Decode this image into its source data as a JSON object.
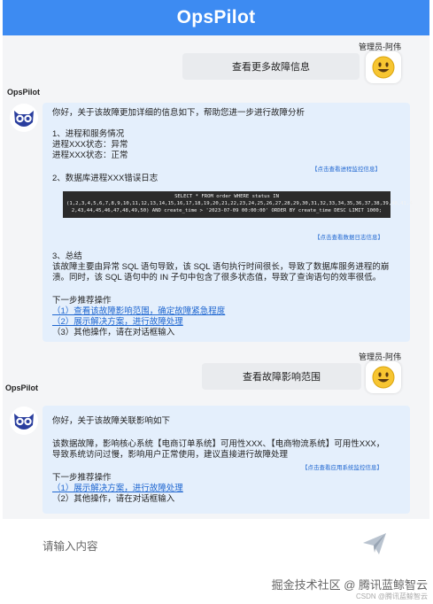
{
  "header": {
    "title": "OpsPilot"
  },
  "conversation": {
    "user_name": "管理员-阿伟",
    "bot_name": "OpsPilot",
    "msg1_user": "查看更多故障信息",
    "msg1_bot": {
      "intro": "你好，关于该故障更加详细的信息如下，帮助您进一步进行故障分析",
      "sec1_title": "1、进程和服务情况",
      "sec1_line1": "进程XXX状态：异常",
      "sec1_line2": "进程XXX状态：正常",
      "sec1_link": "【点击查看进程监控信息】",
      "sec2_title": "2、数据库进程XXX错误日志",
      "code": "SELECT * FROM order WHERE status IN\n(1,2,3,4,5,6,7,8,9,10,11,12,13,14,15,16,17,18,19,20,21,22,23,24,25,26,27,28,29,30,31,32,33,34,35,36,37,38,39,40,41,4\n2,43,44,45,46,47,48,49,50) AND create_time > '2023-07-09 00:00:00' ORDER BY create_time DESC LIMIT 1000;",
      "sec2_link": "【点击查看数据日志信息】",
      "sec3_title": "3、总结",
      "sec3_line1": "该故障主要由异常 SQL 语句导致，该 SQL 语句执行时间很长，导致了数据库服务进程的崩",
      "sec3_line2": "溃。同时，该 SQL 语句中的 IN 子句中包含了很多状态值，导致了查询语句的效率很低。",
      "next_title": "下一步推荐操作",
      "opt1": "（1）查看该故障影响范围，确定故障紧急程度",
      "opt2": "（2）展示解决方案，进行故障处理",
      "opt3": "（3）其他操作，请在对话框输入"
    },
    "msg2_user": "查看故障影响范围",
    "msg2_bot": {
      "intro": "你好，关于该故障关联影响如下",
      "line1": "该数据故障，影响核心系统【电商订单系统】可用性XXX、【电商物流系统】可用性XXX，",
      "line2": "导致系统访问过慢，影响用户正常使用，建议直接进行故障处理",
      "link": "【点击查看应用系统监控信息】",
      "next_title": "下一步推荐操作",
      "opt1": "（1）展示解决方案，进行故障处理",
      "opt2": "（2）其他操作，请在对话框输入"
    }
  },
  "input": {
    "placeholder": "请输入内容"
  },
  "footer": {
    "watermark": "掘金技术社区 @ 腾讯蓝鲸智云",
    "sub": "CSDN @腾讯蓝鲸智云"
  },
  "icons": {
    "user_avatar": "smiley-face-icon",
    "bot_avatar": "owl-icon",
    "send": "paper-plane-icon"
  },
  "colors": {
    "header": "#3d8bf2",
    "link": "#1e66d0",
    "bot_bubble": "#e4effc"
  }
}
